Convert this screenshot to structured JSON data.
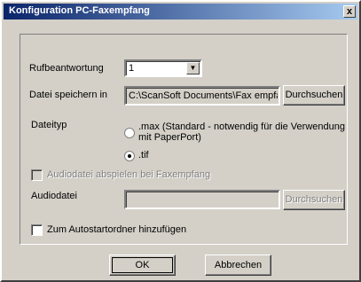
{
  "window": {
    "title": "Konfiguration PC-Faxempfang",
    "close_glyph": "x"
  },
  "rufbeantwortung": {
    "label": "Rufbeantwortung",
    "value": "1"
  },
  "datei": {
    "label": "Datei speichern in",
    "value": "C:\\ScanSoft Documents\\Fax empfa",
    "browse_label": "Durchsuchen"
  },
  "dateityp": {
    "label": "Dateityp",
    "options": [
      {
        "label_line1": ".max (Standard - notwendig für die Verwendung",
        "label_line2": "mit PaperPort)",
        "selected": false
      },
      {
        "label_line1": ".tif",
        "selected": true
      }
    ]
  },
  "audio_checkbox": {
    "label": "Audiodatei abspielen bei Faxempfang",
    "checked": false,
    "enabled": false
  },
  "audiodatei": {
    "label": "Audiodatei",
    "value": "",
    "browse_label": "Durchsuchen"
  },
  "autostart": {
    "label": "Zum Autostartordner hinzufügen",
    "checked": false
  },
  "footer": {
    "ok_label": "OK",
    "cancel_label": "Abbrechen"
  }
}
